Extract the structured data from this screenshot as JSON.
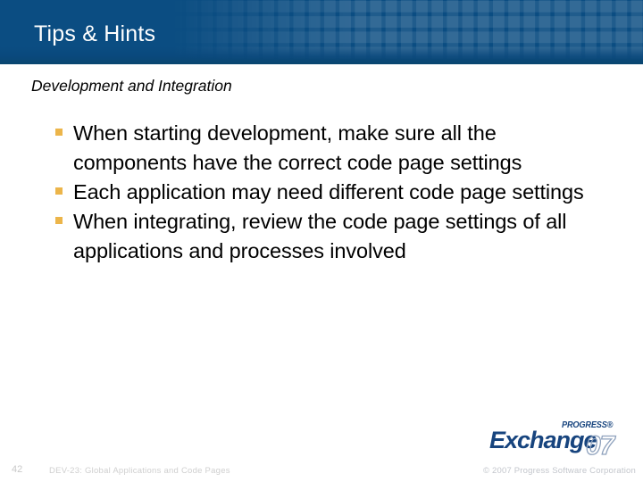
{
  "slide": {
    "title": "Tips & Hints",
    "subtitle": "Development and Integration",
    "bullets": [
      "When starting development, make sure all the components have the correct code page settings",
      "Each application may need different code page settings",
      "When integrating, review the code page settings of all applications and processes involved"
    ]
  },
  "footer": {
    "page_number": "42",
    "course": "DEV-23: Global Applications and Code Pages",
    "copyright": "© 2007 Progress Software Corporation"
  },
  "logo": {
    "brand": "PROGRESS®",
    "product": "Exchange",
    "year": "07"
  },
  "colors": {
    "header_blue": "#0b4d82",
    "header_blue_dark": "#09466f",
    "bullet_marker": "#ecb54a",
    "logo_blue": "#17447e",
    "footer_gray": "#cfcfcf"
  }
}
